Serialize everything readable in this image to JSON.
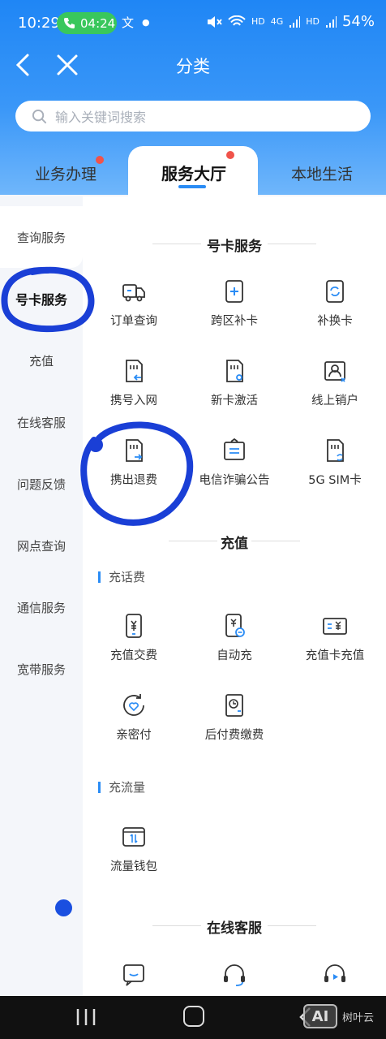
{
  "status": {
    "time": "10:29",
    "call_timer": "04:24",
    "net1": "HD",
    "net2": "4G",
    "net3": "HD",
    "battery": "54%"
  },
  "nav": {
    "title": "分类"
  },
  "search": {
    "placeholder": "输入关键词搜索"
  },
  "tabs": {
    "business": "业务办理",
    "service_hall": "服务大厅",
    "local_life": "本地生活"
  },
  "sidebar": [
    "查询服务",
    "号卡服务",
    "充值",
    "在线客服",
    "问题反馈",
    "网点查询",
    "通信服务",
    "宽带服务"
  ],
  "sections": {
    "number_card": {
      "title": "号卡服务",
      "items": [
        "订单查询",
        "跨区补卡",
        "补换卡",
        "携号入网",
        "新卡激活",
        "线上销户",
        "携出退费",
        "电信诈骗公告",
        "5G SIM卡"
      ]
    },
    "recharge": {
      "title": "充值",
      "sub1": "充话费",
      "items1": [
        "充值交费",
        "自动充",
        "充值卡充值",
        "亲密付",
        "后付费缴费"
      ],
      "sub2": "充流量",
      "items2": [
        "流量钱包"
      ]
    },
    "online_service": {
      "title": "在线客服"
    }
  },
  "watermark": {
    "logo": "AI",
    "text": "树叶云"
  },
  "colors": {
    "accent": "#2a8cf5",
    "header": "#1f86f5",
    "badge": "#f0534a",
    "annotation": "#1a3fd6"
  }
}
